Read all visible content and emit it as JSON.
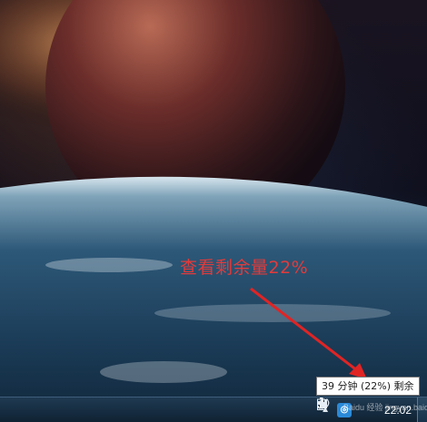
{
  "annotation": {
    "text": "查看剩余量22%",
    "color": "#e23b3b"
  },
  "tooltip": {
    "text": "39 分钟 (22%) 剩余"
  },
  "taskbar": {
    "show_hidden_icon": "up-triangle-icon",
    "show_hidden_glyph": "▲",
    "app_icon_glyph": "◎",
    "clock": "22:02"
  },
  "watermark": {
    "text": "Baidu 经验 jingyan.baidu.com"
  }
}
